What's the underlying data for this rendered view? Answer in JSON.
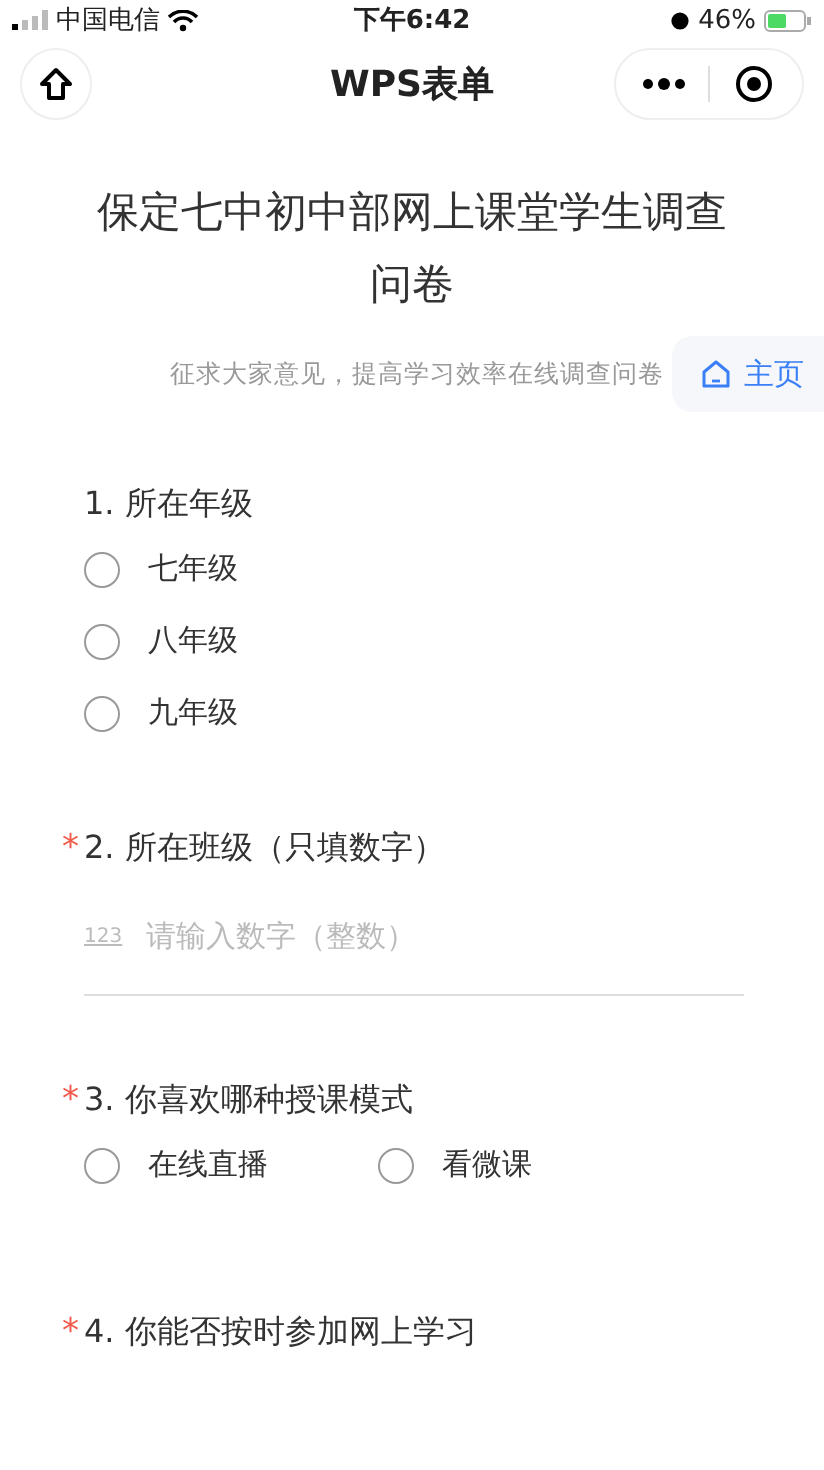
{
  "status_bar": {
    "carrier": "中国电信",
    "time": "下午6:42",
    "battery": "46%"
  },
  "nav": {
    "title": "WPS表单"
  },
  "form": {
    "title": "保定七中初中部网上课堂学生调查问卷",
    "subtitle": "征求大家意见，提高学习效率在线调查问卷",
    "home_button": "主页"
  },
  "questions": [
    {
      "kind": "radio",
      "label": "1. 所在年级",
      "options": [
        {
          "label": "七年级",
          "selected": false
        },
        {
          "label": "八年级",
          "selected": false
        },
        {
          "label": "九年级",
          "selected": false
        }
      ]
    },
    {
      "kind": "number",
      "required_mark": "*",
      "label": "2. 所在班级（只填数字）",
      "input_icon": "123",
      "placeholder": "请输入数字（整数）"
    },
    {
      "kind": "radio_inline",
      "required_mark": "*",
      "label": "3. 你喜欢哪种授课模式",
      "options": [
        {
          "label": "在线直播",
          "selected": false
        },
        {
          "label": "看微课",
          "selected": false
        }
      ]
    },
    {
      "kind": "heading",
      "required_mark": "*",
      "label": "4. 你能否按时参加网上学习"
    }
  ]
}
